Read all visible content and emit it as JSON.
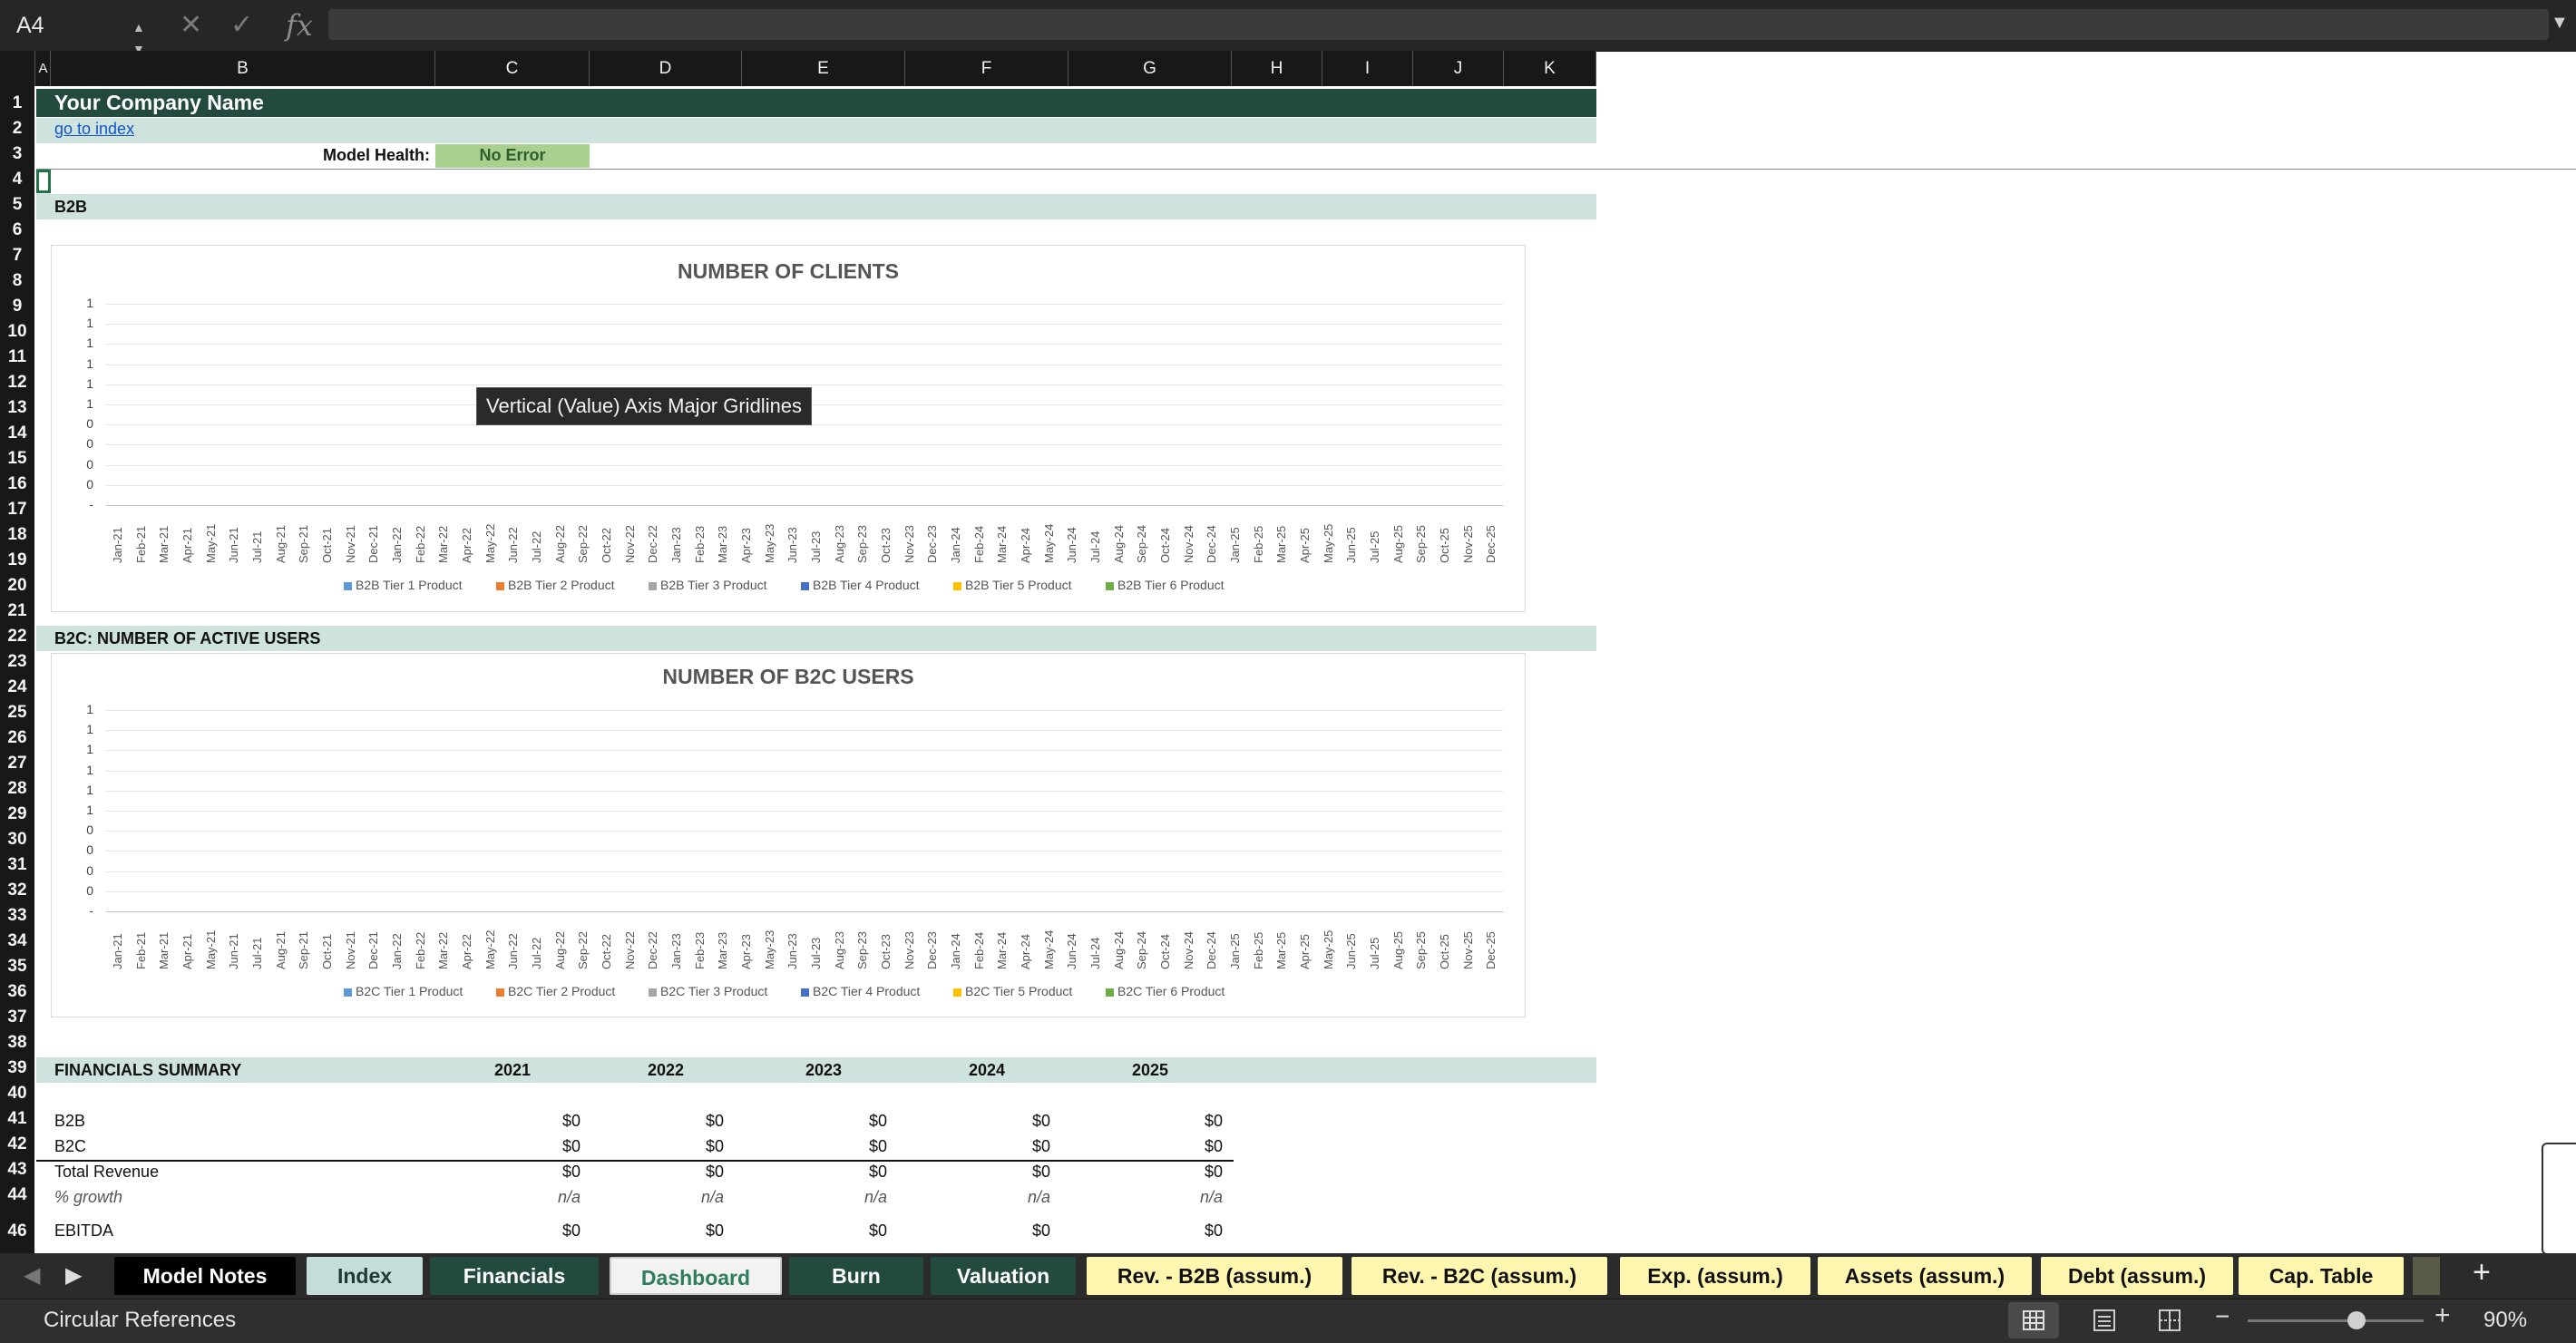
{
  "formula_bar": {
    "name_box": "A4",
    "cancel_icon": "close-icon",
    "enter_icon": "check-icon",
    "fx_label": "fx",
    "formula": ""
  },
  "columns": [
    "A",
    "B",
    "C",
    "D",
    "E",
    "F",
    "G",
    "H",
    "I",
    "J",
    "K"
  ],
  "rows": [
    "1",
    "2",
    "3",
    "4",
    "5",
    "6",
    "7",
    "8",
    "9",
    "10",
    "11",
    "12",
    "13",
    "14",
    "15",
    "16",
    "17",
    "18",
    "19",
    "20",
    "21",
    "22",
    "23",
    "24",
    "25",
    "26",
    "27",
    "28",
    "29",
    "30",
    "31",
    "32",
    "33",
    "34",
    "35",
    "36",
    "37",
    "38",
    "39",
    "40",
    "41",
    "42",
    "43",
    "44",
    "46"
  ],
  "sheet": {
    "company": "Your Company Name",
    "index_link": "go to index",
    "model_health_label": "Model Health:",
    "model_health_value": "No Error",
    "b2b_header": "B2B",
    "b2c_header": "B2C: NUMBER OF ACTIVE USERS",
    "fin_header": "FINANCIALS SUMMARY",
    "years": [
      "2021",
      "2022",
      "2023",
      "2024",
      "2025"
    ],
    "fin_rows": [
      {
        "label": "B2B",
        "values": [
          "$0",
          "$0",
          "$0",
          "$0",
          "$0"
        ]
      },
      {
        "label": "B2C",
        "values": [
          "$0",
          "$0",
          "$0",
          "$0",
          "$0"
        ]
      },
      {
        "label": "Total Revenue",
        "values": [
          "$0",
          "$0",
          "$0",
          "$0",
          "$0"
        ]
      },
      {
        "label": "% growth",
        "values": [
          "n/a",
          "n/a",
          "n/a",
          "n/a",
          "n/a"
        ]
      },
      {
        "label": "EBITDA",
        "values": [
          "$0",
          "$0",
          "$0",
          "$0",
          "$0"
        ]
      }
    ]
  },
  "tooltip": "Vertical (Value) Axis Major Gridlines",
  "chart_data": [
    {
      "type": "bar",
      "title": "NUMBER OF CLIENTS",
      "y_ticks": [
        "1",
        "1",
        "1",
        "1",
        "1",
        "1",
        "0",
        "0",
        "0",
        "0",
        "-"
      ],
      "categories": [
        "Jan-21",
        "Feb-21",
        "Mar-21",
        "Apr-21",
        "May-21",
        "Jun-21",
        "Jul-21",
        "Aug-21",
        "Sep-21",
        "Oct-21",
        "Nov-21",
        "Dec-21",
        "Jan-22",
        "Feb-22",
        "Mar-22",
        "Apr-22",
        "May-22",
        "Jun-22",
        "Jul-22",
        "Aug-22",
        "Sep-22",
        "Oct-22",
        "Nov-22",
        "Dec-22",
        "Jan-23",
        "Feb-23",
        "Mar-23",
        "Apr-23",
        "May-23",
        "Jun-23",
        "Jul-23",
        "Aug-23",
        "Sep-23",
        "Oct-23",
        "Nov-23",
        "Dec-23",
        "Jan-24",
        "Feb-24",
        "Mar-24",
        "Apr-24",
        "May-24",
        "Jun-24",
        "Jul-24",
        "Aug-24",
        "Sep-24",
        "Oct-24",
        "Nov-24",
        "Dec-24",
        "Jan-25",
        "Feb-25",
        "Mar-25",
        "Apr-25",
        "May-25",
        "Jun-25",
        "Jul-25",
        "Aug-25",
        "Sep-25",
        "Oct-25",
        "Nov-25",
        "Dec-25"
      ],
      "series": [
        {
          "name": "B2B Tier 1 Product",
          "color": "#5b9bd5",
          "values": []
        },
        {
          "name": "B2B Tier 2 Product",
          "color": "#ed7d31",
          "values": []
        },
        {
          "name": "B2B Tier 3 Product",
          "color": "#a5a5a5",
          "values": []
        },
        {
          "name": "B2B Tier 4 Product",
          "color": "#4472c4",
          "values": []
        },
        {
          "name": "B2B Tier 5 Product",
          "color": "#ffc000",
          "values": []
        },
        {
          "name": "B2B Tier 6 Product",
          "color": "#70ad47",
          "values": []
        }
      ],
      "legend": "bottom",
      "grid": true
    },
    {
      "type": "bar",
      "title": "NUMBER OF B2C USERS",
      "y_ticks": [
        "1",
        "1",
        "1",
        "1",
        "1",
        "1",
        "0",
        "0",
        "0",
        "0",
        "-"
      ],
      "categories": [
        "Jan-21",
        "Feb-21",
        "Mar-21",
        "Apr-21",
        "May-21",
        "Jun-21",
        "Jul-21",
        "Aug-21",
        "Sep-21",
        "Oct-21",
        "Nov-21",
        "Dec-21",
        "Jan-22",
        "Feb-22",
        "Mar-22",
        "Apr-22",
        "May-22",
        "Jun-22",
        "Jul-22",
        "Aug-22",
        "Sep-22",
        "Oct-22",
        "Nov-22",
        "Dec-22",
        "Jan-23",
        "Feb-23",
        "Mar-23",
        "Apr-23",
        "May-23",
        "Jun-23",
        "Jul-23",
        "Aug-23",
        "Sep-23",
        "Oct-23",
        "Nov-23",
        "Dec-23",
        "Jan-24",
        "Feb-24",
        "Mar-24",
        "Apr-24",
        "May-24",
        "Jun-24",
        "Jul-24",
        "Aug-24",
        "Sep-24",
        "Oct-24",
        "Nov-24",
        "Dec-24",
        "Jan-25",
        "Feb-25",
        "Mar-25",
        "Apr-25",
        "May-25",
        "Jun-25",
        "Jul-25",
        "Aug-25",
        "Sep-25",
        "Oct-25",
        "Nov-25",
        "Dec-25"
      ],
      "series": [
        {
          "name": "B2C Tier 1 Product",
          "color": "#5b9bd5",
          "values": []
        },
        {
          "name": "B2C Tier 2 Product",
          "color": "#ed7d31",
          "values": []
        },
        {
          "name": "B2C Tier 3 Product",
          "color": "#a5a5a5",
          "values": []
        },
        {
          "name": "B2C Tier 4 Product",
          "color": "#4472c4",
          "values": []
        },
        {
          "name": "B2C Tier 5 Product",
          "color": "#ffc000",
          "values": []
        },
        {
          "name": "B2C Tier 6 Product",
          "color": "#70ad47",
          "values": []
        }
      ],
      "legend": "bottom",
      "grid": true
    }
  ],
  "tabs": [
    {
      "label": "Model Notes",
      "bg": "#000000",
      "fg": "#ffffff"
    },
    {
      "label": "Index",
      "bg": "#c5ddd8",
      "fg": "#1f3a33"
    },
    {
      "label": "Financials",
      "bg": "#234a3e",
      "fg": "#ffffff"
    },
    {
      "label": "Dashboard",
      "bg": "#f2f2f2",
      "fg": "#2e7d5b",
      "active": true
    },
    {
      "label": "Burn",
      "bg": "#234a3e",
      "fg": "#ffffff"
    },
    {
      "label": "Valuation",
      "bg": "#234a3e",
      "fg": "#ffffff"
    },
    {
      "label": "Rev. - B2B (assum.)",
      "bg": "#fff7b0",
      "fg": "#111111"
    },
    {
      "label": "Rev. - B2C (assum.)",
      "bg": "#fff7b0",
      "fg": "#111111"
    },
    {
      "label": "Exp. (assum.)",
      "bg": "#fff7b0",
      "fg": "#111111"
    },
    {
      "label": "Assets (assum.)",
      "bg": "#fff7b0",
      "fg": "#111111"
    },
    {
      "label": "Debt (assum.)",
      "bg": "#fff7b0",
      "fg": "#111111"
    },
    {
      "label": "Cap. Table",
      "bg": "#fff7b0",
      "fg": "#111111"
    }
  ],
  "status": {
    "left_text": "Circular References",
    "zoom": "90%",
    "zoom_level": 0.62,
    "add_sheet": "+",
    "zoom_minus": "−",
    "zoom_plus": "+"
  }
}
